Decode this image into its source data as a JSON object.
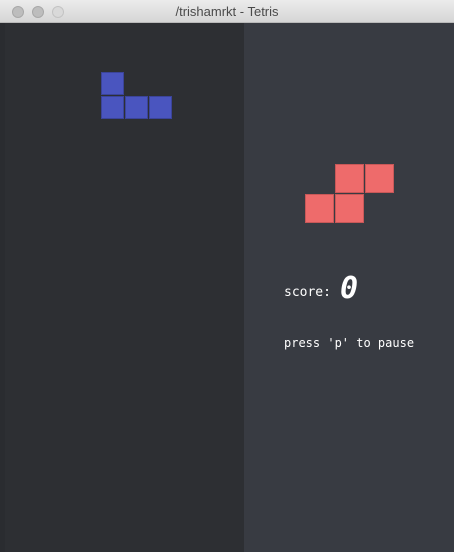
{
  "window": {
    "title": "/trishamrkt - Tetris"
  },
  "game": {
    "score_label": "score:",
    "score_value": "0",
    "pause_hint": "press 'p' to pause",
    "colors": {
      "board_bg": "#2d2f33",
      "panel_bg": "#383b42",
      "active_piece": "#4a55bf",
      "next_piece": "#ee6b6b"
    },
    "active_piece": {
      "shape": "J",
      "color": "blue"
    },
    "next_piece": {
      "shape": "S",
      "color": "red"
    }
  }
}
